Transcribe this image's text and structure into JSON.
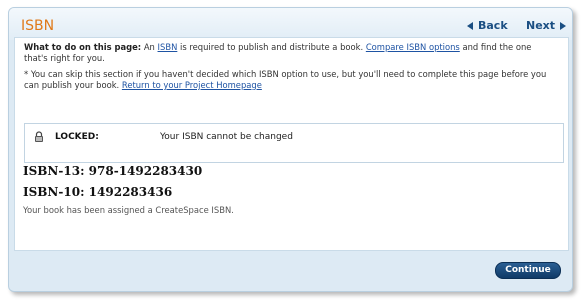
{
  "header": {
    "title": "ISBN",
    "back_label": "Back",
    "next_label": "Next"
  },
  "instructions": {
    "heading": "What to do on this page:",
    "text_before_link1": " An ",
    "link1": "ISBN",
    "text_between": " is required to publish and distribute a book. ",
    "link2": "Compare ISBN options",
    "text_after": " and find the one that's right for you.",
    "note": "* You can skip this section if you haven't decided which ISBN option to use, but you'll need to complete this page before you can publish your book. ",
    "note_link": "Return to your Project Homepage"
  },
  "locked": {
    "label": "LOCKED:",
    "message": "Your ISBN cannot be changed"
  },
  "isbn": {
    "isbn13": "ISBN-13: 978-1492283430",
    "isbn10": "ISBN-10: 1492283436",
    "assigned_note": "Your book has been assigned a CreateSpace ISBN."
  },
  "footer": {
    "continue_label": "Continue"
  },
  "colors": {
    "title_orange": "#e07a1a",
    "link_blue": "#1e53a3",
    "button_navy": "#0f3a67"
  }
}
